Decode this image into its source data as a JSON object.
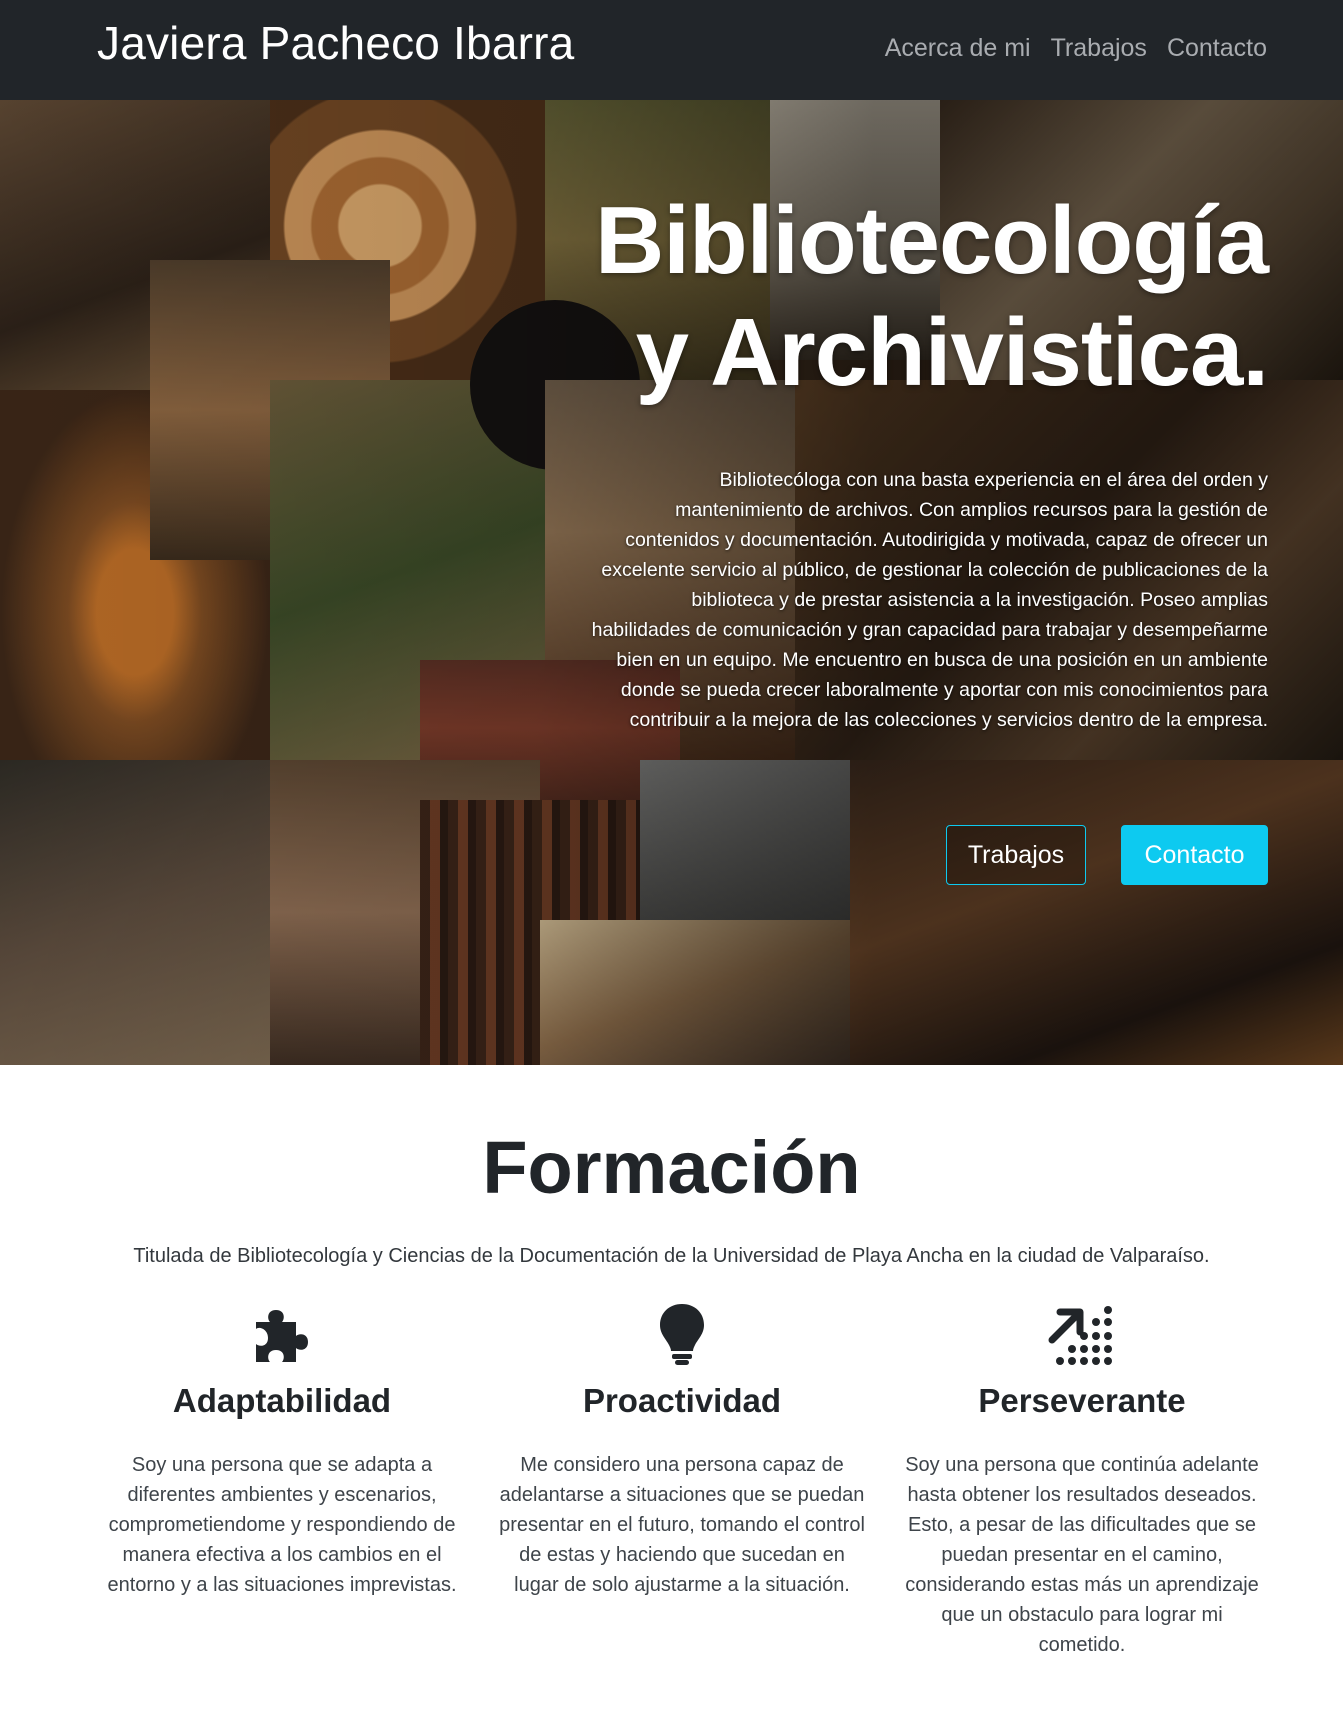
{
  "navbar": {
    "brand": "Javiera Pacheco Ibarra",
    "links": [
      "Acerca de mi",
      "Trabajos",
      "Contacto"
    ]
  },
  "hero": {
    "title_line1": "Bibliotecología",
    "title_line2": "y Archivistica.",
    "description": "Bibliotecóloga con una basta experiencia en el área del orden y mantenimiento de archivos. Con amplios recursos para la gestión de contenidos y documentación. Autodirigida y motivada, capaz de ofrecer un excelente servicio al público, de gestionar la colección de publicaciones de la biblioteca y de prestar asistencia a la investigación. Poseo amplias habilidades de comunicación y gran capacidad para trabajar y desempeñarme bien en un equipo. Me encuentro en busca de una posición en un ambiente donde se pueda crecer laboralmente y aportar con mis conocimientos para contribuir a la mejora de las colecciones y servicios dentro de la empresa.",
    "buttons": {
      "outline": "Trabajos",
      "primary": "Contacto"
    },
    "accent_color": "#0dcaf0"
  },
  "formacion": {
    "title": "Formación",
    "lead": "Titulada de Bibliotecología y Ciencias de la Documentación de la Universidad de Playa Ancha en la ciudad de Valparaíso.",
    "features": [
      {
        "icon": "puzzle-piece-icon",
        "title": "Adaptabilidad",
        "text": "Soy una persona que se adapta a diferentes ambientes y escenarios, comprometiendome y respondiendo de manera efectiva a los cambios en el entorno y a las situaciones imprevistas."
      },
      {
        "icon": "lightbulb-icon",
        "title": "Proactividad",
        "text": "Me considero una persona capaz de adelantarse a situaciones que se puedan presentar en el futuro, tomando el control de estas y haciendo que sucedan en lugar de solo ajustarme a la situación."
      },
      {
        "icon": "arrow-dots-icon",
        "title": "Perseverante",
        "text": "Soy una persona que continúa adelante hasta obtener los resultados deseados. Esto, a pesar de las dificultades que se puedan presentar en el camino, considerando estas más un aprendizaje que un obstaculo para lograr mi cometido."
      }
    ]
  }
}
